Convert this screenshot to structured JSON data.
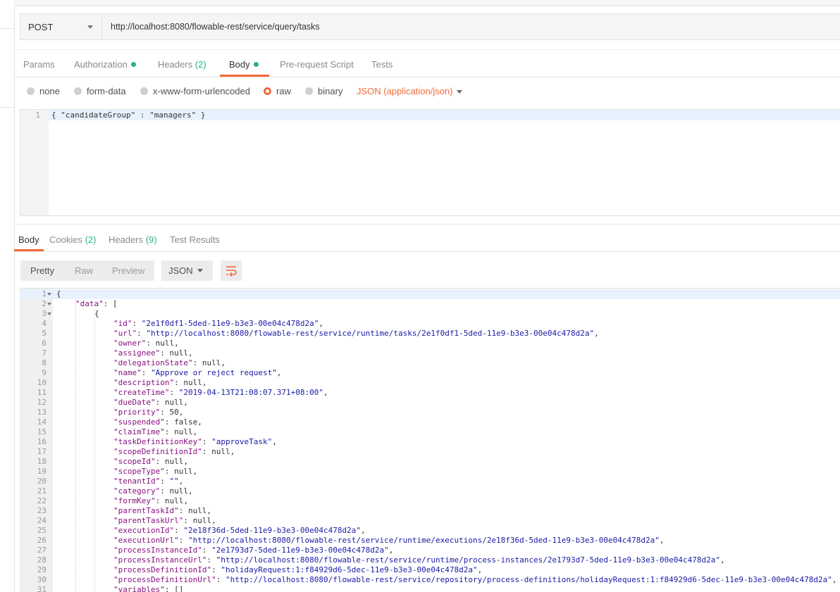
{
  "request": {
    "method": "POST",
    "url": "http://localhost:8080/flowable-rest/service/query/tasks"
  },
  "request_tabs": {
    "params": "Params",
    "authorization": "Authorization",
    "headers": "Headers",
    "headers_count": "(2)",
    "body": "Body",
    "prerequest": "Pre-request Script",
    "tests": "Tests"
  },
  "body_modes": {
    "none": "none",
    "form_data": "form-data",
    "urlencoded": "x-www-form-urlencoded",
    "raw": "raw",
    "binary": "binary",
    "content_type": "JSON (application/json)"
  },
  "request_body": {
    "line_number": "1",
    "text": "{ \"candidateGroup\" : \"managers\" }"
  },
  "response_tabs": {
    "body": "Body",
    "cookies": "Cookies",
    "cookies_count": "(2)",
    "headers": "Headers",
    "headers_count": "(9)",
    "test_results": "Test Results"
  },
  "response_toolbar": {
    "pretty": "Pretty",
    "raw": "Raw",
    "preview": "Preview",
    "format": "JSON"
  },
  "colors": {
    "accent": "#f26b3a",
    "green": "#26b47f"
  },
  "response_lines": [
    {
      "n": "1",
      "fold": true,
      "indent": 0,
      "k": "",
      "v": "{",
      "vc": "p"
    },
    {
      "n": "2",
      "fold": true,
      "indent": 1,
      "k": "\"data\"",
      "v": ": [",
      "vc": "p"
    },
    {
      "n": "3",
      "fold": true,
      "indent": 2,
      "k": "",
      "v": "{",
      "vc": "p"
    },
    {
      "n": "4",
      "indent": 3,
      "k": "\"id\"",
      "v": "\"2e1f0df1-5ded-11e9-b3e3-00e04c478d2a\"",
      "vc": "s"
    },
    {
      "n": "5",
      "indent": 3,
      "k": "\"url\"",
      "v": "\"http://localhost:8080/flowable-rest/service/runtime/tasks/2e1f0df1-5ded-11e9-b3e3-00e04c478d2a\"",
      "vc": "s"
    },
    {
      "n": "6",
      "indent": 3,
      "k": "\"owner\"",
      "v": "null",
      "vc": "p"
    },
    {
      "n": "7",
      "indent": 3,
      "k": "\"assignee\"",
      "v": "null",
      "vc": "p"
    },
    {
      "n": "8",
      "indent": 3,
      "k": "\"delegationState\"",
      "v": "null",
      "vc": "p"
    },
    {
      "n": "9",
      "indent": 3,
      "k": "\"name\"",
      "v": "\"Approve or reject request\"",
      "vc": "s"
    },
    {
      "n": "10",
      "indent": 3,
      "k": "\"description\"",
      "v": "null",
      "vc": "p"
    },
    {
      "n": "11",
      "indent": 3,
      "k": "\"createTime\"",
      "v": "\"2019-04-13T21:08:07.371+08:00\"",
      "vc": "s"
    },
    {
      "n": "12",
      "indent": 3,
      "k": "\"dueDate\"",
      "v": "null",
      "vc": "p"
    },
    {
      "n": "13",
      "indent": 3,
      "k": "\"priority\"",
      "v": "50",
      "vc": "p"
    },
    {
      "n": "14",
      "indent": 3,
      "k": "\"suspended\"",
      "v": "false",
      "vc": "p"
    },
    {
      "n": "15",
      "indent": 3,
      "k": "\"claimTime\"",
      "v": "null",
      "vc": "p"
    },
    {
      "n": "16",
      "indent": 3,
      "k": "\"taskDefinitionKey\"",
      "v": "\"approveTask\"",
      "vc": "s"
    },
    {
      "n": "17",
      "indent": 3,
      "k": "\"scopeDefinitionId\"",
      "v": "null",
      "vc": "p"
    },
    {
      "n": "18",
      "indent": 3,
      "k": "\"scopeId\"",
      "v": "null",
      "vc": "p"
    },
    {
      "n": "19",
      "indent": 3,
      "k": "\"scopeType\"",
      "v": "null",
      "vc": "p"
    },
    {
      "n": "20",
      "indent": 3,
      "k": "\"tenantId\"",
      "v": "\"\"",
      "vc": "s"
    },
    {
      "n": "21",
      "indent": 3,
      "k": "\"category\"",
      "v": "null",
      "vc": "p"
    },
    {
      "n": "22",
      "indent": 3,
      "k": "\"formKey\"",
      "v": "null",
      "vc": "p"
    },
    {
      "n": "23",
      "indent": 3,
      "k": "\"parentTaskId\"",
      "v": "null",
      "vc": "p"
    },
    {
      "n": "24",
      "indent": 3,
      "k": "\"parentTaskUrl\"",
      "v": "null",
      "vc": "p"
    },
    {
      "n": "25",
      "indent": 3,
      "k": "\"executionId\"",
      "v": "\"2e18f36d-5ded-11e9-b3e3-00e04c478d2a\"",
      "vc": "s"
    },
    {
      "n": "26",
      "indent": 3,
      "k": "\"executionUrl\"",
      "v": "\"http://localhost:8080/flowable-rest/service/runtime/executions/2e18f36d-5ded-11e9-b3e3-00e04c478d2a\"",
      "vc": "s"
    },
    {
      "n": "27",
      "indent": 3,
      "k": "\"processInstanceId\"",
      "v": "\"2e1793d7-5ded-11e9-b3e3-00e04c478d2a\"",
      "vc": "s"
    },
    {
      "n": "28",
      "indent": 3,
      "k": "\"processInstanceUrl\"",
      "v": "\"http://localhost:8080/flowable-rest/service/runtime/process-instances/2e1793d7-5ded-11e9-b3e3-00e04c478d2a\"",
      "vc": "s"
    },
    {
      "n": "29",
      "indent": 3,
      "k": "\"processDefinitionId\"",
      "v": "\"holidayRequest:1:f84929d6-5dec-11e9-b3e3-00e04c478d2a\"",
      "vc": "s"
    },
    {
      "n": "30",
      "indent": 3,
      "k": "\"processDefinitionUrl\"",
      "v": "\"http://localhost:8080/flowable-rest/service/repository/process-definitions/holidayRequest:1:f84929d6-5dec-11e9-b3e3-00e04c478d2a\"",
      "vc": "s"
    },
    {
      "n": "31",
      "indent": 3,
      "k": "\"variables\"",
      "v": "[]",
      "vc": "p"
    }
  ]
}
